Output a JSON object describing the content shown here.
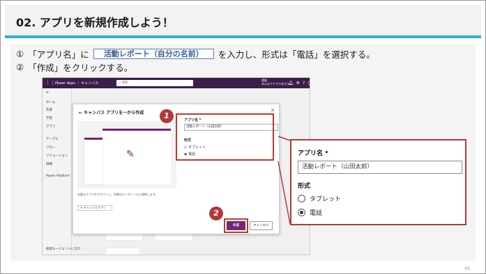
{
  "slide": {
    "title": "02. アプリを新規作成しよう！",
    "page_number": "45"
  },
  "instructions": {
    "step1_num": "①",
    "step1_before": "「アプリ名」に",
    "step1_input": "活動レポート（自分の名前）",
    "step1_after": "を入力し、形式は「電話」を選択する。",
    "step2_num": "②",
    "step2_text": "「作成」をクリックする。"
  },
  "power_apps": {
    "app_title": "Power Apps ｜ キャンバス",
    "search_placeholder": "検索",
    "environment_label": "環境",
    "environment_name": "みんなでアプリ作ろう...",
    "sidebar": [
      "ホーム",
      "作成",
      "学習",
      "アプリ",
      "テーブル",
      "フロー",
      "ソリューション",
      "詳細",
      "Power Platform"
    ],
    "sidebar_bottom": "仮想エージェントに質問",
    "dialog": {
      "title": "キャンバス アプリを一から作成",
      "description": "必要なアプリをデザインし、多数のデータソースに接続します。",
      "learn_more": "キャンバスアプリ",
      "app_name_label": "アプリ名 *",
      "app_name_value": "活動レポート（山田太郎）",
      "format_label": "形式",
      "option_tablet": "タブレット",
      "option_phone": "電話",
      "create_button": "作成",
      "cancel_button": "キャンセル"
    }
  },
  "callouts": {
    "badge1": "1",
    "badge2": "2"
  },
  "zoom_panel": {
    "app_name_label": "アプリ名 *",
    "app_name_value": "活動レポート（山田太郎）",
    "format_label": "形式",
    "option_tablet": "タブレット",
    "option_phone": "電話",
    "selected_option": "電話"
  },
  "colors": {
    "accent_teal": "#2fb5c5",
    "callout_red": "#b03a3a",
    "power_apps_purple": "#742774"
  }
}
